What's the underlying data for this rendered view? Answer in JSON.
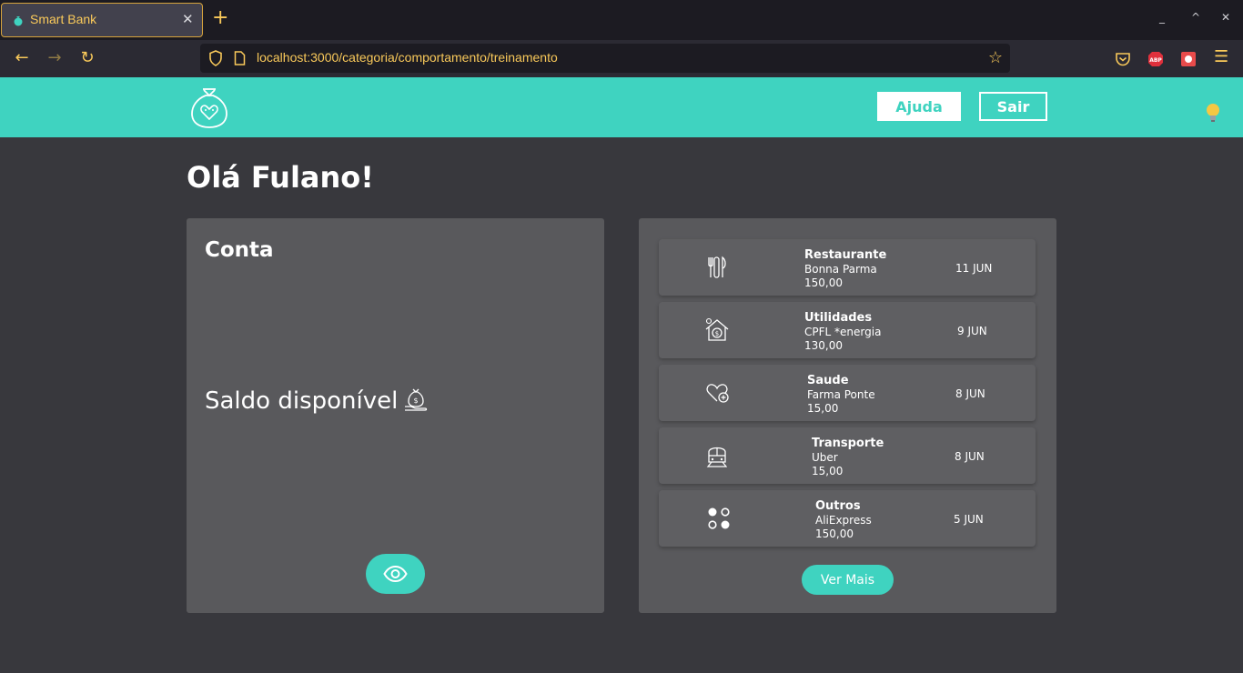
{
  "browser": {
    "tab_title": "Smart Bank",
    "tab_close": "✕",
    "new_tab": "+",
    "url": "localhost:3000/categoria/comportamento/treinamento",
    "window_controls": [
      "_",
      "^",
      "✕"
    ]
  },
  "header": {
    "help_label": "Ajuda",
    "logout_label": "Sair"
  },
  "greeting": "Olá Fulano!",
  "account": {
    "title": "Conta",
    "balance_label": "Saldo disponível"
  },
  "transactions": [
    {
      "icon": "cutlery-icon",
      "category": "Restaurante",
      "merchant": "Bonna Parma",
      "amount": "150,00",
      "date": "11 JUN"
    },
    {
      "icon": "house-money-icon",
      "category": "Utilidades",
      "merchant": "CPFL *energia",
      "amount": "130,00",
      "date": "9 JUN"
    },
    {
      "icon": "health-heart-icon",
      "category": "Saude",
      "merchant": "Farma Ponte",
      "amount": "15,00",
      "date": "8 JUN"
    },
    {
      "icon": "train-icon",
      "category": "Transporte",
      "merchant": "Uber",
      "amount": "15,00",
      "date": "8 JUN"
    },
    {
      "icon": "dots-icon",
      "category": "Outros",
      "merchant": "AliExpress",
      "amount": "150,00",
      "date": "5 JUN"
    }
  ],
  "more_label": "Ver Mais",
  "colors": {
    "accent": "#3fd3c0",
    "card": "#59595c",
    "background": "#38383d"
  }
}
